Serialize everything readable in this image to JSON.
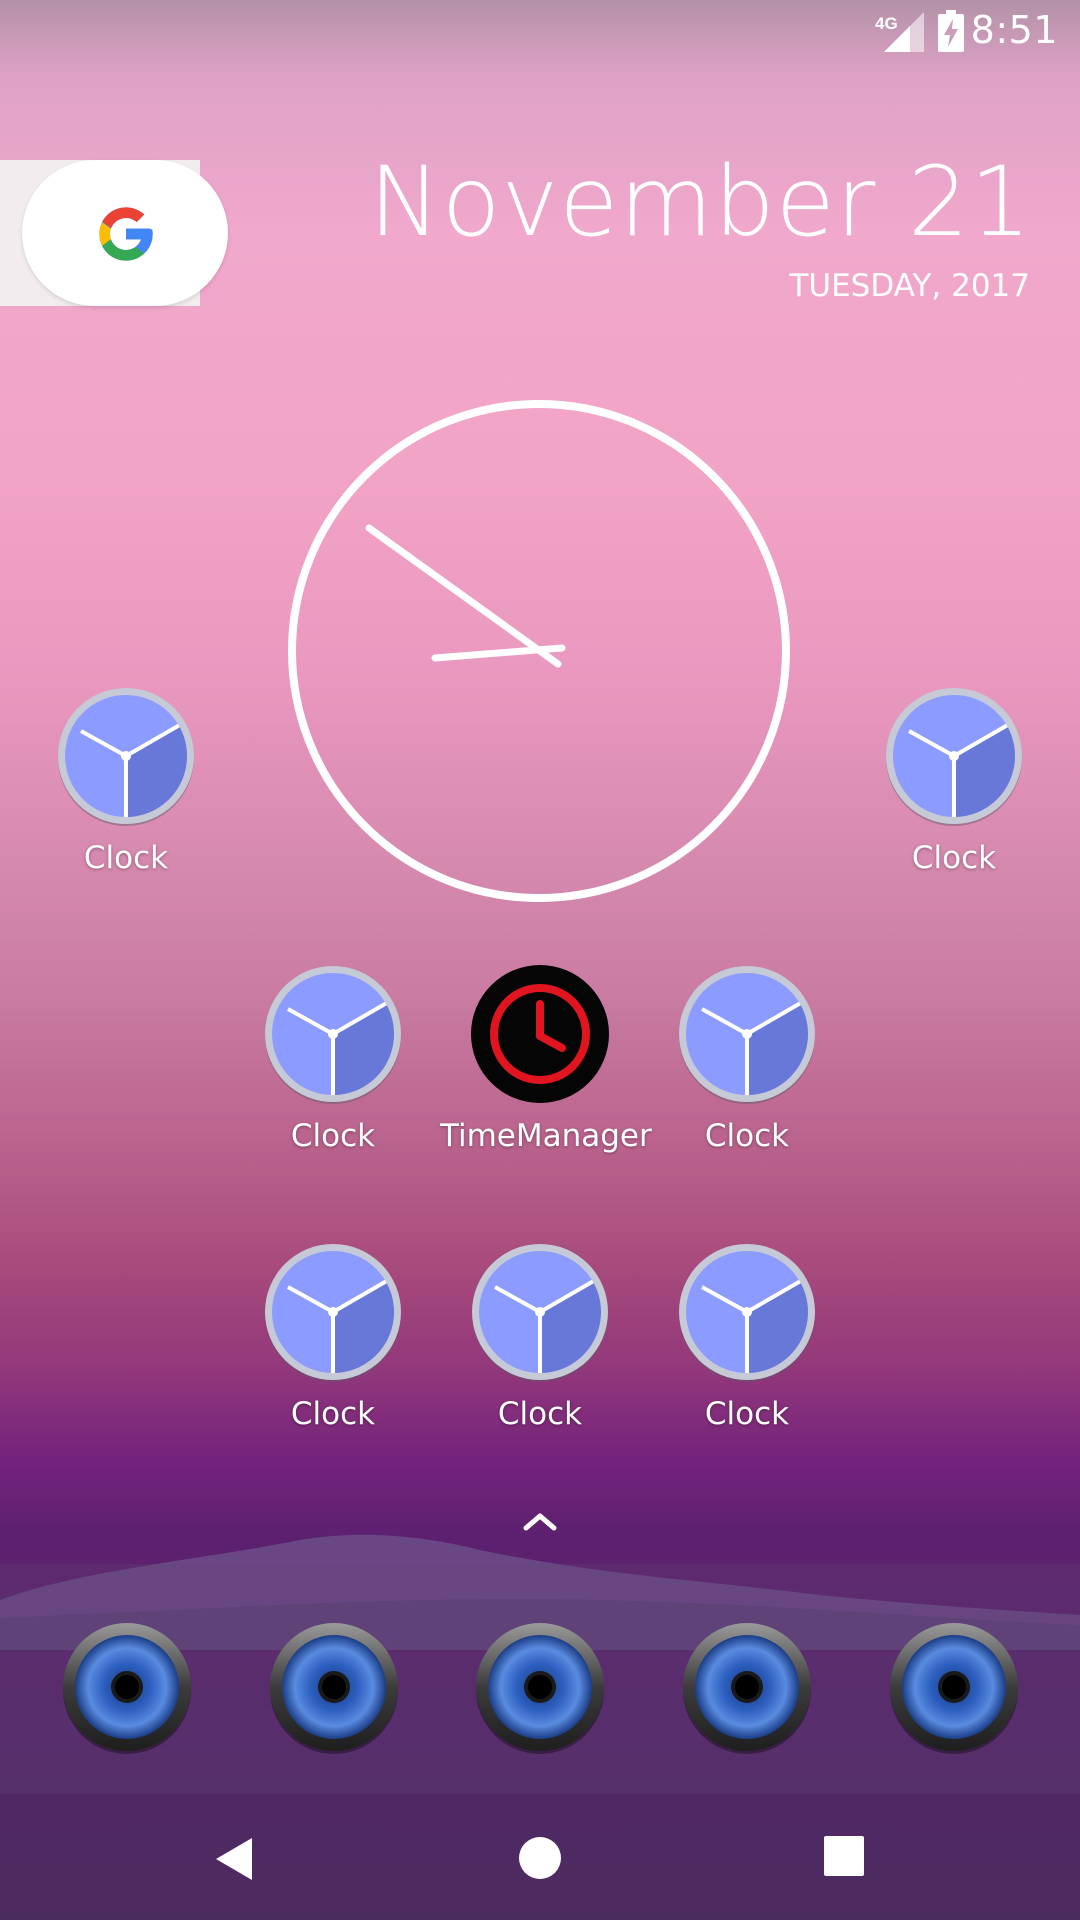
{
  "status_bar": {
    "network": "4G",
    "time": "8:51"
  },
  "date_widget": {
    "date": "November 21",
    "weekday_year": "TUESDAY, 2017"
  },
  "search": {
    "icon": "google-icon"
  },
  "widget_clock": {
    "face": "analog-clock-icon"
  },
  "apps": [
    {
      "label": "Clock",
      "icon": "clock-icon"
    },
    {
      "label": "Clock",
      "icon": "clock-icon"
    },
    {
      "label": "Clock",
      "icon": "clock-icon"
    },
    {
      "label": "TimeManager",
      "icon": "timemanager-icon"
    },
    {
      "label": "Clock",
      "icon": "clock-icon"
    },
    {
      "label": "Clock",
      "icon": "clock-icon"
    },
    {
      "label": "Clock",
      "icon": "clock-icon"
    },
    {
      "label": "Clock",
      "icon": "clock-icon"
    }
  ],
  "dock": {
    "items": [
      "speaker-icon",
      "speaker-icon",
      "speaker-icon",
      "speaker-icon",
      "speaker-icon"
    ]
  },
  "nav": {
    "back": "back-icon",
    "home": "home-icon",
    "recents": "recents-icon"
  },
  "colors": {
    "clock_face": "#8c9bff",
    "timemanager_red": "#e0151f"
  }
}
